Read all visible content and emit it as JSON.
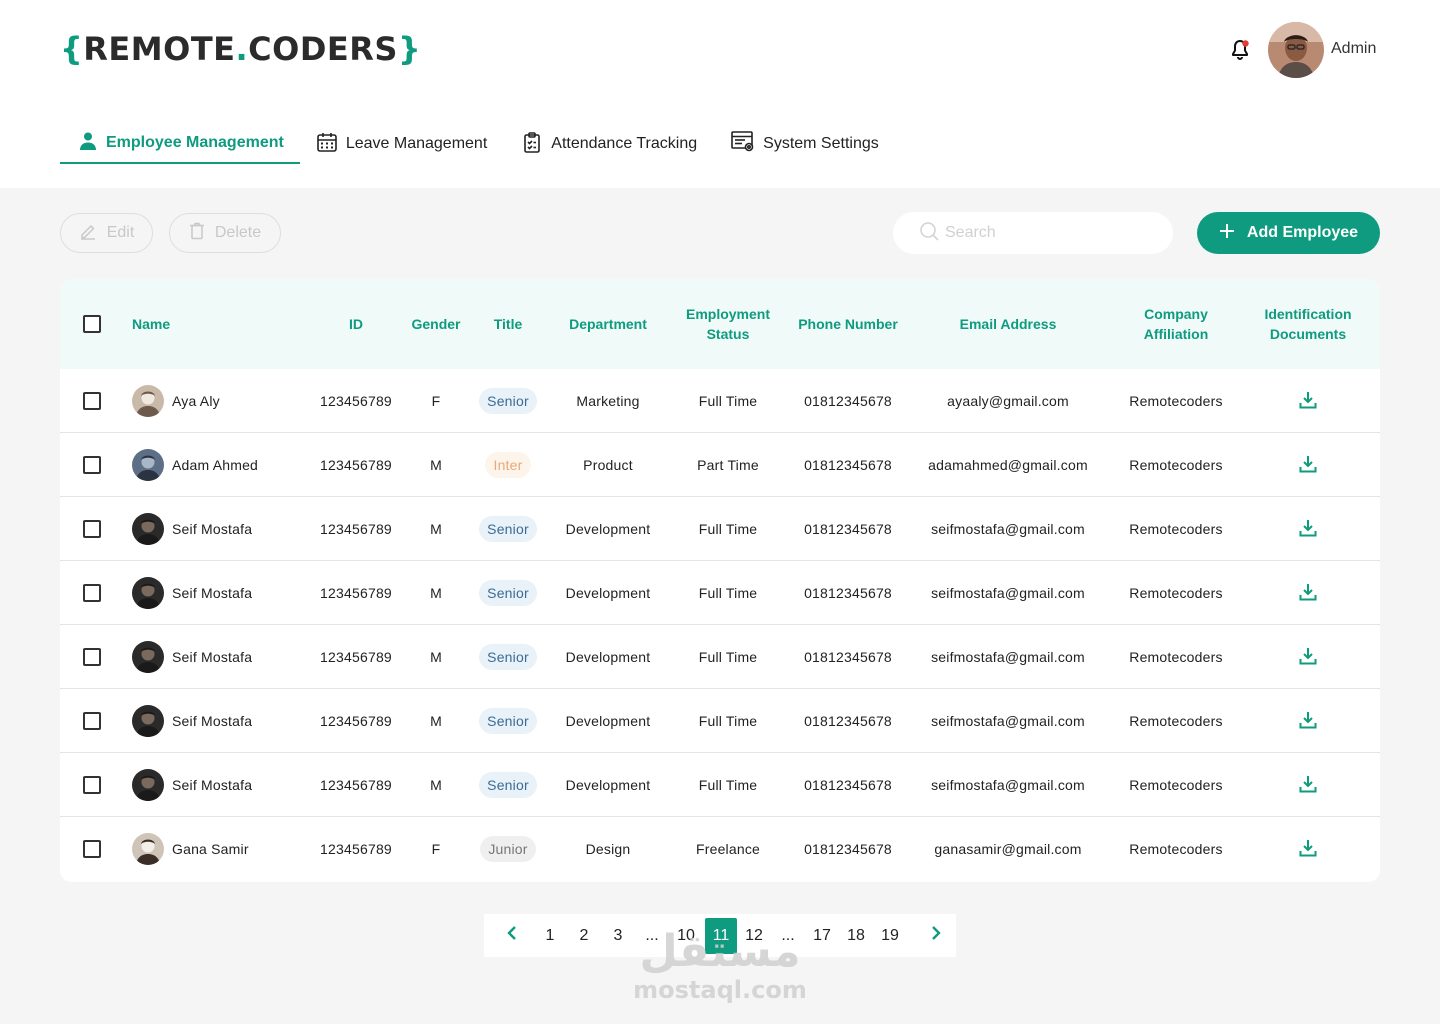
{
  "header": {
    "logo": {
      "open": "{",
      "part1": "REMOTE",
      "dot": ".",
      "part2": "CODERS",
      "close": "}"
    },
    "user_name": "Admin"
  },
  "tabs": [
    {
      "label": "Employee Management",
      "icon": "user-icon",
      "active": true
    },
    {
      "label": "Leave Management",
      "icon": "calendar-icon",
      "active": false
    },
    {
      "label": "Attendance Tracking",
      "icon": "clipboard-icon",
      "active": false
    },
    {
      "label": "System Settings",
      "icon": "settings-panel-icon",
      "active": false
    }
  ],
  "toolbar": {
    "edit_label": "Edit",
    "delete_label": "Delete",
    "search_placeholder": "Search",
    "add_label": "Add Employee"
  },
  "table": {
    "columns": [
      "Name",
      "ID",
      "Gender",
      "Title",
      "Department",
      "Employment Status",
      "Phone Number",
      "Email Address",
      "Company Affiliation",
      "Identification Documents"
    ],
    "rows": [
      {
        "name": "Aya Aly",
        "id": "123456789",
        "gender": "F",
        "title": "Senior",
        "department": "Marketing",
        "status": "Full Time",
        "phone": "01812345678",
        "email": "ayaaly@gmail.com",
        "company": "Remotecoders"
      },
      {
        "name": "Adam Ahmed",
        "id": "123456789",
        "gender": "M",
        "title": "Inter",
        "department": "Product",
        "status": "Part Time",
        "phone": "01812345678",
        "email": "adamahmed@gmail.com",
        "company": "Remotecoders"
      },
      {
        "name": "Seif Mostafa",
        "id": "123456789",
        "gender": "M",
        "title": "Senior",
        "department": "Development",
        "status": "Full Time",
        "phone": "01812345678",
        "email": "seifmostafa@gmail.com",
        "company": "Remotecoders"
      },
      {
        "name": "Seif Mostafa",
        "id": "123456789",
        "gender": "M",
        "title": "Senior",
        "department": "Development",
        "status": "Full Time",
        "phone": "01812345678",
        "email": "seifmostafa@gmail.com",
        "company": "Remotecoders"
      },
      {
        "name": "Seif Mostafa",
        "id": "123456789",
        "gender": "M",
        "title": "Senior",
        "department": "Development",
        "status": "Full Time",
        "phone": "01812345678",
        "email": "seifmostafa@gmail.com",
        "company": "Remotecoders"
      },
      {
        "name": "Seif Mostafa",
        "id": "123456789",
        "gender": "M",
        "title": "Senior",
        "department": "Development",
        "status": "Full Time",
        "phone": "01812345678",
        "email": "seifmostafa@gmail.com",
        "company": "Remotecoders"
      },
      {
        "name": "Seif Mostafa",
        "id": "123456789",
        "gender": "M",
        "title": "Senior",
        "department": "Development",
        "status": "Full Time",
        "phone": "01812345678",
        "email": "seifmostafa@gmail.com",
        "company": "Remotecoders"
      },
      {
        "name": "Gana Samir",
        "id": "123456789",
        "gender": "F",
        "title": "Junior",
        "department": "Design",
        "status": "Freelance",
        "phone": "01812345678",
        "email": "ganasamir@gmail.com",
        "company": "Remotecoders"
      }
    ]
  },
  "pagination": {
    "pages": [
      "1",
      "2",
      "3",
      "...",
      "10",
      "11",
      "12",
      "...",
      "17",
      "18",
      "19"
    ],
    "current": "11"
  },
  "watermark": {
    "arabic": "مستقل",
    "latin": "mostaql.com"
  },
  "colors": {
    "accent": "#0e9b7f",
    "header_bg": "#f0faf8",
    "page_bg": "#f5f5f5",
    "notification_dot": "#e53935"
  }
}
